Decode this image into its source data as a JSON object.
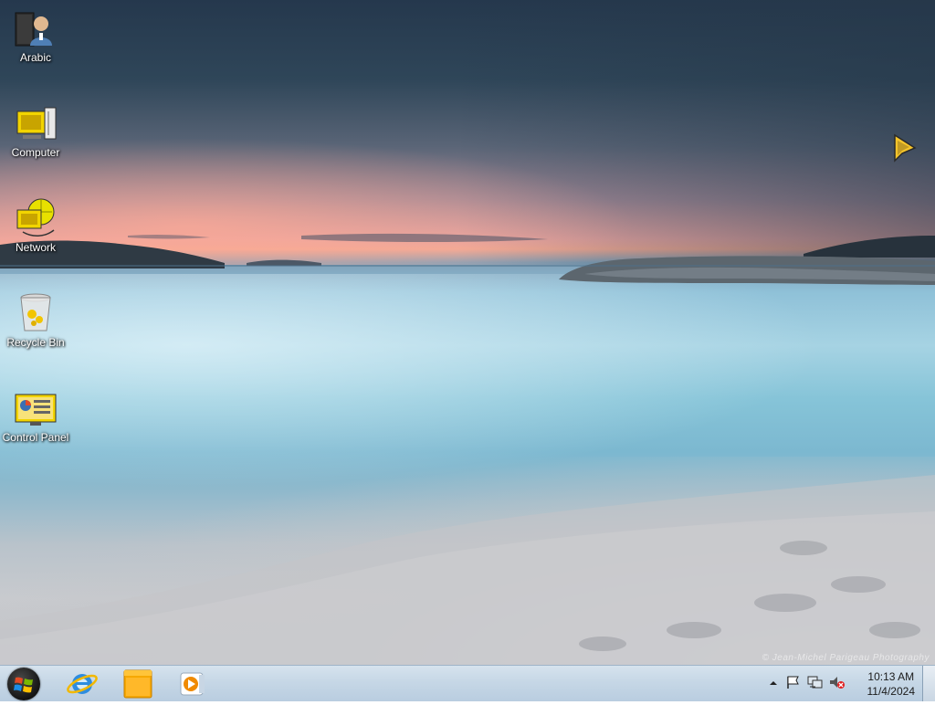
{
  "desktop_icons": [
    {
      "label": "Arabic",
      "icon": "user-folder-icon"
    },
    {
      "label": "Computer",
      "icon": "computer-icon"
    },
    {
      "label": "Network",
      "icon": "network-icon"
    },
    {
      "label": "Recycle Bin",
      "icon": "recycle-bin-icon"
    },
    {
      "label": "Control Panel",
      "icon": "control-panel-icon"
    }
  ],
  "taskbar": {
    "pinned_apps": [
      {
        "name": "Internet Explorer",
        "icon": "internet-explorer-icon"
      },
      {
        "name": "Windows Explorer",
        "icon": "folder-icon"
      },
      {
        "name": "Windows Media Player",
        "icon": "media-player-icon"
      }
    ],
    "tray": {
      "time": "10:13 AM",
      "date": "11/4/2024"
    }
  },
  "watermark": "© Jean-Michel Parigeau Photography",
  "colors": {
    "taskbar": "#c6d7e6",
    "accent": "#f2c500"
  }
}
